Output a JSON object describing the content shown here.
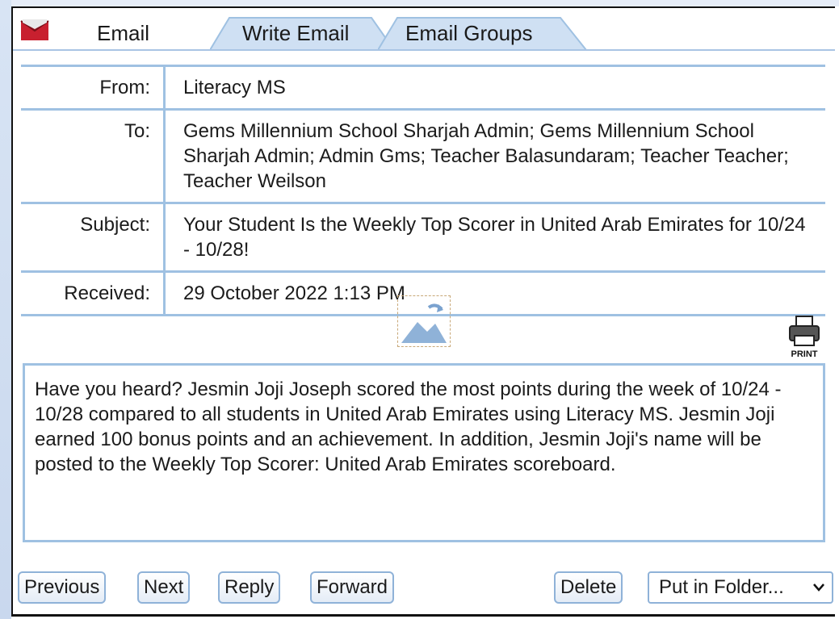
{
  "tabs": [
    {
      "label": "Email",
      "active": true
    },
    {
      "label": "Write Email",
      "active": false
    },
    {
      "label": "Email Groups",
      "active": false
    }
  ],
  "meta": {
    "from_label": "From:",
    "from_value": "Literacy MS",
    "to_label": "To:",
    "to_value": "Gems Millennium School Sharjah Admin; Gems Millennium School Sharjah Admin; Admin Gms; Teacher Balasundaram; Teacher Teacher; Teacher Weilson",
    "subject_label": "Subject:",
    "subject_value": "Your Student Is the Weekly Top Scorer in United Arab Emirates for 10/24 - 10/28!",
    "received_label": "Received:",
    "received_value": "29 October 2022 1:13 PM"
  },
  "print_label": "PRINT",
  "message_body": "Have you heard? Jesmin Joji Joseph scored the most points during the week of 10/24 - 10/28 compared to all students in United Arab Emirates using Literacy MS. Jesmin Joji earned 100 bonus points and an achievement. In addition, Jesmin Joji's name will be posted to the Weekly Top Scorer: United Arab Emirates scoreboard.",
  "buttons": {
    "previous": "Previous",
    "next": "Next",
    "reply": "Reply",
    "forward": "Forward",
    "delete": "Delete"
  },
  "folder_select": {
    "selected": "Put in Folder..."
  },
  "colors": {
    "accent": "#9fc1e2",
    "tab_fill": "#cfe0f3",
    "icon_red": "#c8202f"
  },
  "icons": {
    "mail": "envelope-icon",
    "print": "printer-icon",
    "image": "image-placeholder-icon"
  }
}
